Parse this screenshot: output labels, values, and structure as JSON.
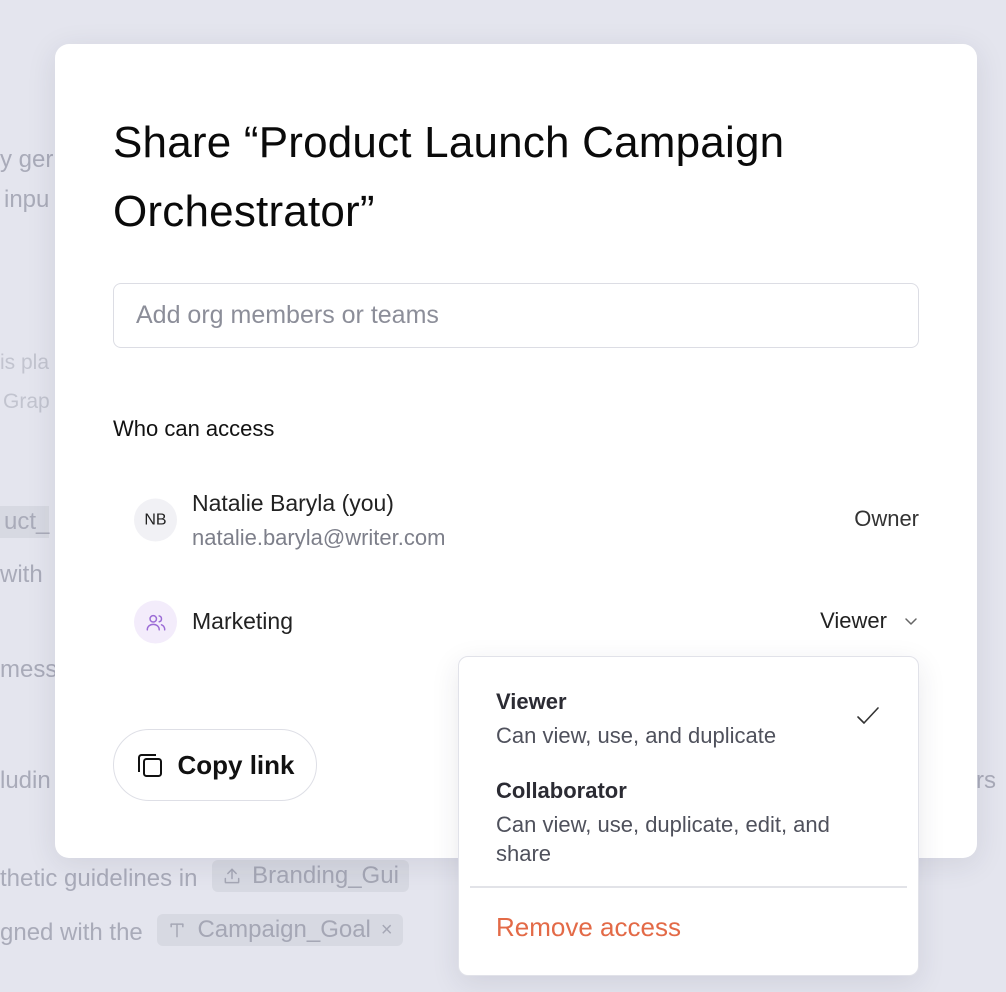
{
  "background": {
    "lines": [
      {
        "text": "y ger"
      },
      {
        "text": "inpu"
      },
      {
        "text": "is pla"
      },
      {
        "text": "Grap"
      },
      {
        "text": "uct_"
      },
      {
        "text": "with"
      },
      {
        "text": "mess"
      },
      {
        "text": "ludin"
      },
      {
        "text": "rs"
      },
      {
        "text": "thetic guidelines in"
      },
      {
        "text": "gned with the"
      }
    ],
    "chips": [
      {
        "label": "Branding_Gui",
        "icon": "upload-icon"
      },
      {
        "label": "Campaign_Goal",
        "icon": "text-icon"
      }
    ]
  },
  "modal": {
    "title": "Share “Product Launch Campaign Orchestrator”",
    "search": {
      "placeholder": "Add org members or teams",
      "value": ""
    },
    "section_label": "Who can access",
    "members": [
      {
        "initials": "NB",
        "name": "Natalie Baryla (you)",
        "email": "natalie.baryla@writer.com",
        "role": "Owner"
      },
      {
        "name": "Marketing",
        "role": "Viewer",
        "icon": "users-icon"
      }
    ],
    "copy_link_label": "Copy link"
  },
  "dropdown": {
    "options": [
      {
        "title": "Viewer",
        "description": "Can view, use, and duplicate",
        "selected": true
      },
      {
        "title": "Collaborator",
        "description": "Can view, use, duplicate, edit, and share",
        "selected": false
      }
    ],
    "remove_label": "Remove access"
  },
  "colors": {
    "backdrop": "#e4e5ee",
    "modal_bg": "#ffffff",
    "danger": "#e36a47",
    "team_avatar_bg": "#f3ecfb",
    "team_icon": "#9b6bd6"
  }
}
